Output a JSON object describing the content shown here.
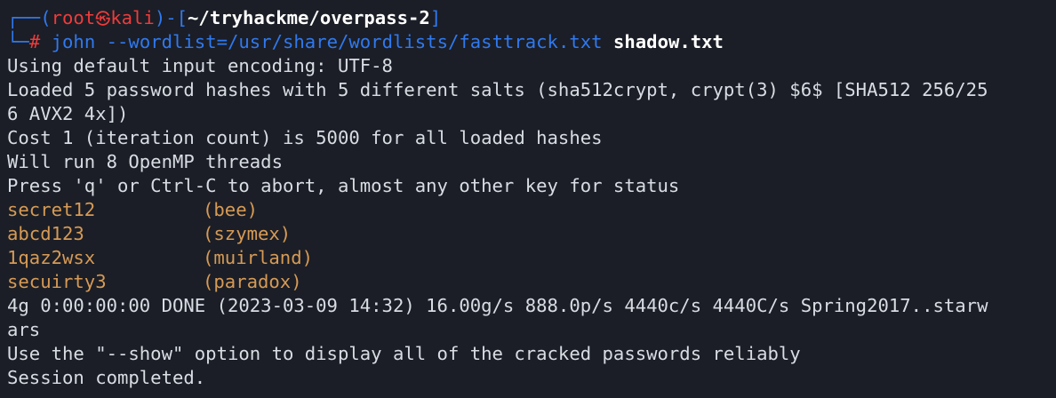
{
  "terminal": {
    "prompt": {
      "corner_top": "┌──(",
      "user": "root",
      "skull": "㉿",
      "host": "kali",
      "dir_open": ")-[",
      "cwd": "~/tryhackme/overpass-2",
      "dir_close": "]",
      "corner_bottom": "└─",
      "symbol": "#",
      "command": "john --wordlist=/usr/share/wordlists/fasttrack.txt",
      "argument": "shadow.txt"
    },
    "output_lines": [
      "Using default input encoding: UTF-8",
      "Loaded 5 password hashes with 5 different salts (sha512crypt, crypt(3) $6$ [SHA512 256/25",
      "6 AVX2 4x])",
      "Cost 1 (iteration count) is 5000 for all loaded hashes",
      "Will run 8 OpenMP threads",
      "Press 'q' or Ctrl-C to abort, almost any other key for status"
    ],
    "cracked": [
      {
        "password": "secret12",
        "user": "(bee)"
      },
      {
        "password": "abcd123",
        "user": "(szymex)"
      },
      {
        "password": "1qaz2wsx",
        "user": "(muirland)"
      },
      {
        "password": "secuirty3",
        "user": "(paradox)"
      }
    ],
    "summary_lines": [
      "4g 0:00:00:00 DONE (2023-03-09 14:32) 16.00g/s 888.0p/s 4440c/s 4440C/s Spring2017..starw",
      "ars",
      "Use the \"--show\" option to display all of the cracked passwords reliably",
      "Session completed."
    ],
    "colors": {
      "background": "#1b1e26",
      "prompt_blue": "#2f79f0",
      "prompt_red": "#ef3b3b",
      "cracked_orange": "#d69a55",
      "text": "#d8dce3"
    }
  }
}
